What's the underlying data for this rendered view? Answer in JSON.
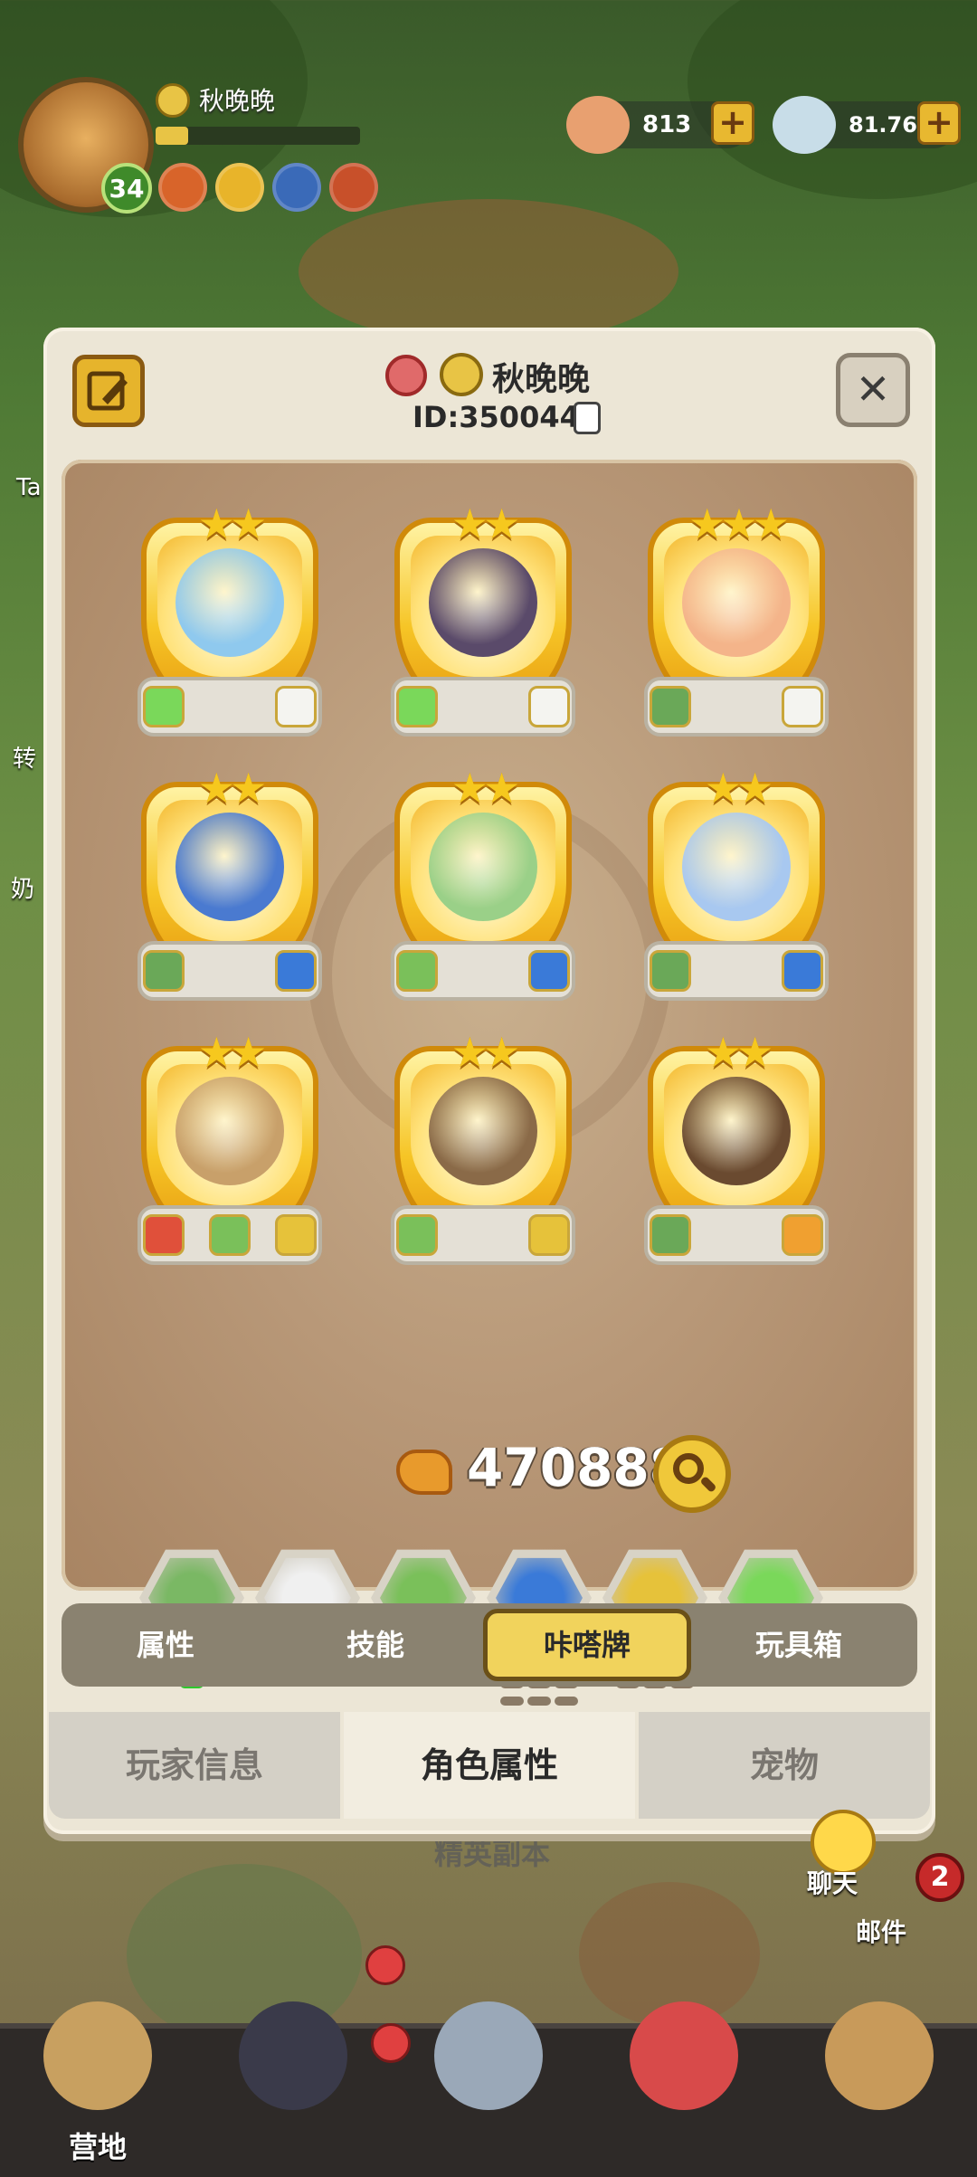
{
  "player": {
    "name": "秋晚晚",
    "level": "34",
    "id_text": "ID:3500441"
  },
  "resources": [
    {
      "icon": "shell-coin-icon",
      "value": "813"
    },
    {
      "icon": "stone-currency-icon",
      "value": "81.76M"
    }
  ],
  "side_labels": [
    "Ta",
    "转",
    "奶"
  ],
  "modal": {
    "cards": [
      {
        "name": "ram",
        "stars": 2,
        "elements": [
          "grassland-element-icon",
          "cotton-element-icon"
        ],
        "color": "#8fc9ee"
      },
      {
        "name": "shadow-beast",
        "stars": 2,
        "elements": [
          "grassland-element-icon",
          "cotton-element-icon"
        ],
        "color": "#5a4a6a"
      },
      {
        "name": "mandrake",
        "stars": 3,
        "elements": [
          "leaf-element-icon",
          "cotton-element-icon"
        ],
        "color": "#f4b48a"
      },
      {
        "name": "blue-wolf",
        "stars": 2,
        "elements": [
          "leaf-element-icon",
          "tornado-element-icon"
        ],
        "color": "#4a7ad0"
      },
      {
        "name": "leaf-fox",
        "stars": 2,
        "elements": [
          "cactus-element-icon",
          "tornado-element-icon"
        ],
        "color": "#9ad088"
      },
      {
        "name": "wind-dragon",
        "stars": 2,
        "elements": [
          "leaf-element-icon",
          "tornado-element-icon"
        ],
        "color": "#a8c8f0"
      },
      {
        "name": "stone-golem",
        "stars": 2,
        "elements": [
          "volcano-element-icon",
          "cactus-element-icon",
          "shield-element-icon"
        ],
        "color": "#c8a06a"
      },
      {
        "name": "earth-dragon",
        "stars": 2,
        "elements": [
          "cactus-element-icon",
          "shield-element-icon"
        ],
        "color": "#8a6a48"
      },
      {
        "name": "mammoth",
        "stars": 2,
        "elements": [
          "leaf-element-icon",
          "tusk-element-icon"
        ],
        "color": "#6a4a30"
      }
    ],
    "power": "470888",
    "synergies": [
      {
        "icon": "leaf-element-icon",
        "color": "#7ab864",
        "dots": 4,
        "on": 4
      },
      {
        "icon": "cotton-element-icon",
        "color": "#f0f0f0",
        "dots": 3,
        "on": 3
      },
      {
        "icon": "cactus-element-icon",
        "color": "#7ac05a",
        "dots": 3,
        "on": 3
      },
      {
        "icon": "tornado-element-icon",
        "color": "#3a7ad8",
        "dots": 9,
        "on": 3
      },
      {
        "icon": "shield-element-icon",
        "color": "#e6c23a",
        "dots": 6,
        "on": 2
      },
      {
        "icon": "grassland-element-icon",
        "color": "#7ad85a",
        "dots": 2,
        "on": 2
      }
    ],
    "subtabs": [
      "属性",
      "技能",
      "咔嗒牌",
      "玩具箱"
    ],
    "active_subtab": 2,
    "maintabs": [
      "玩家信息",
      "角色属性",
      "宠物"
    ],
    "active_maintab": 1
  },
  "background_labels": {
    "elite": "精英副本"
  },
  "chat": {
    "label": "聊天"
  },
  "mail": {
    "label": "邮件",
    "badge": "2"
  },
  "bottom_nav": [
    {
      "label": "营地",
      "icon": "camp-icon"
    },
    {
      "label": "",
      "icon": "hero-icon"
    },
    {
      "label": "",
      "icon": "weapon-icon"
    },
    {
      "label": "",
      "icon": "pet-icon"
    },
    {
      "label": "",
      "icon": "totem-icon"
    }
  ]
}
